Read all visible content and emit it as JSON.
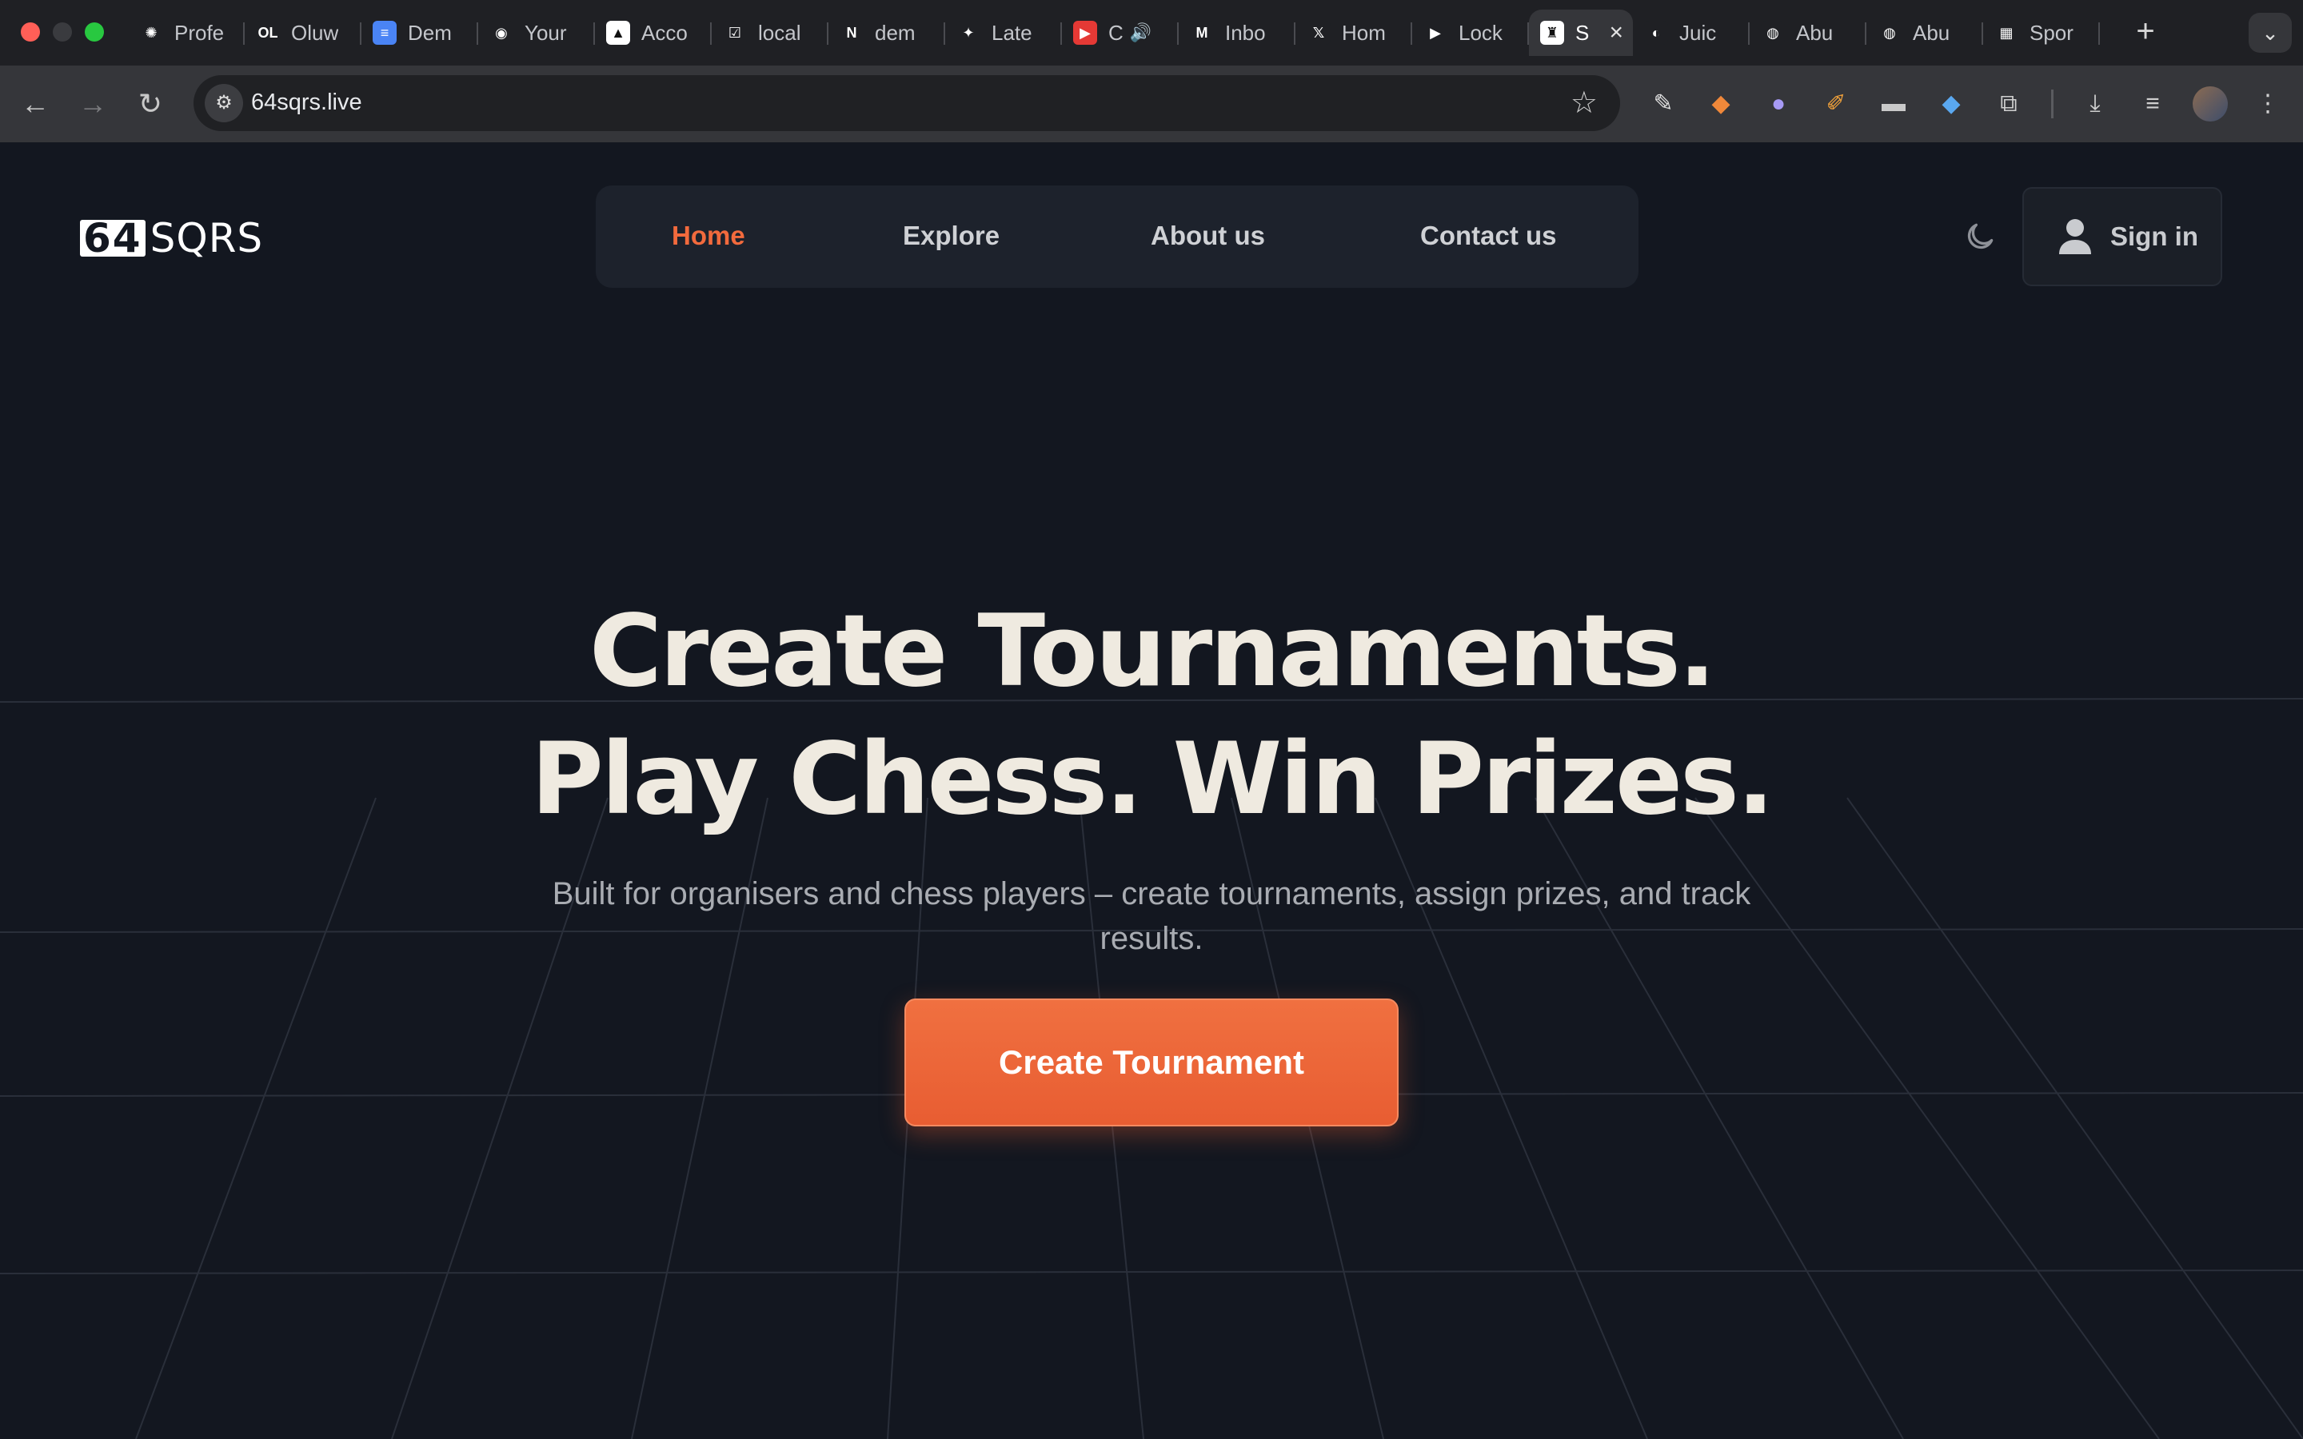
{
  "browser": {
    "tabs": [
      {
        "label": "Profe",
        "icon": "chatgpt-icon",
        "fav_bg": "#1f2024",
        "glyph": "✺"
      },
      {
        "label": "Oluw",
        "icon": "openlibrary-icon",
        "fav_bg": "#1f2024",
        "glyph": "OL"
      },
      {
        "label": "Dem",
        "icon": "google-docs-icon",
        "fav_bg": "#4a84f5",
        "glyph": "≡"
      },
      {
        "label": "Your",
        "icon": "github-icon",
        "fav_bg": "#1f2024",
        "glyph": "◉"
      },
      {
        "label": "Acco",
        "icon": "vercel-icon",
        "fav_bg": "#ffffff",
        "glyph": "▲"
      },
      {
        "label": "local",
        "icon": "checklist-icon",
        "fav_bg": "#1f2024",
        "glyph": "☑"
      },
      {
        "label": "dem",
        "icon": "notion-icon",
        "fav_bg": "#1f2024",
        "glyph": "N"
      },
      {
        "label": "Late",
        "icon": "figma-icon",
        "fav_bg": "#1f2024",
        "glyph": "✦"
      },
      {
        "label": "C",
        "icon": "youtube-music-icon",
        "fav_bg": "#e53935",
        "glyph": "▶",
        "audio": true
      },
      {
        "label": "Inbo",
        "icon": "gmail-icon",
        "fav_bg": "#1f2024",
        "glyph": "M"
      },
      {
        "label": "Hom",
        "icon": "x-icon",
        "fav_bg": "#1f2024",
        "glyph": "𝕏"
      },
      {
        "label": "Lock",
        "icon": "google-play-icon",
        "fav_bg": "#1f2024",
        "glyph": "▶"
      },
      {
        "label": "S",
        "icon": "chess-rook-icon",
        "fav_bg": "#ffffff",
        "glyph": "♜",
        "active": true
      },
      {
        "label": "Juic",
        "icon": "juicy-icon",
        "fav_bg": "#1f2024",
        "glyph": "◐"
      },
      {
        "label": "Abu",
        "icon": "globe-icon",
        "fav_bg": "#1f2024",
        "glyph": "◍"
      },
      {
        "label": "Abu",
        "icon": "globe-icon",
        "fav_bg": "#1f2024",
        "glyph": "◍"
      },
      {
        "label": "Spor",
        "icon": "sporty-icon",
        "fav_bg": "#1f2024",
        "glyph": "▦"
      }
    ],
    "url": "64sqrs.live"
  },
  "site": {
    "logo_mark": "64",
    "logo_text": "SQRS",
    "nav": {
      "home": "Home",
      "explore": "Explore",
      "about": "About us",
      "contact": "Contact us"
    },
    "signin_label": "Sign in",
    "accent_color": "#f26a3d"
  },
  "hero": {
    "title_line1": "Create Tournaments.",
    "title_line2": "Play Chess. Win Prizes.",
    "subtitle": "Built for organisers and chess players – create tournaments, assign prizes, and track results.",
    "cta_label": "Create Tournament"
  }
}
